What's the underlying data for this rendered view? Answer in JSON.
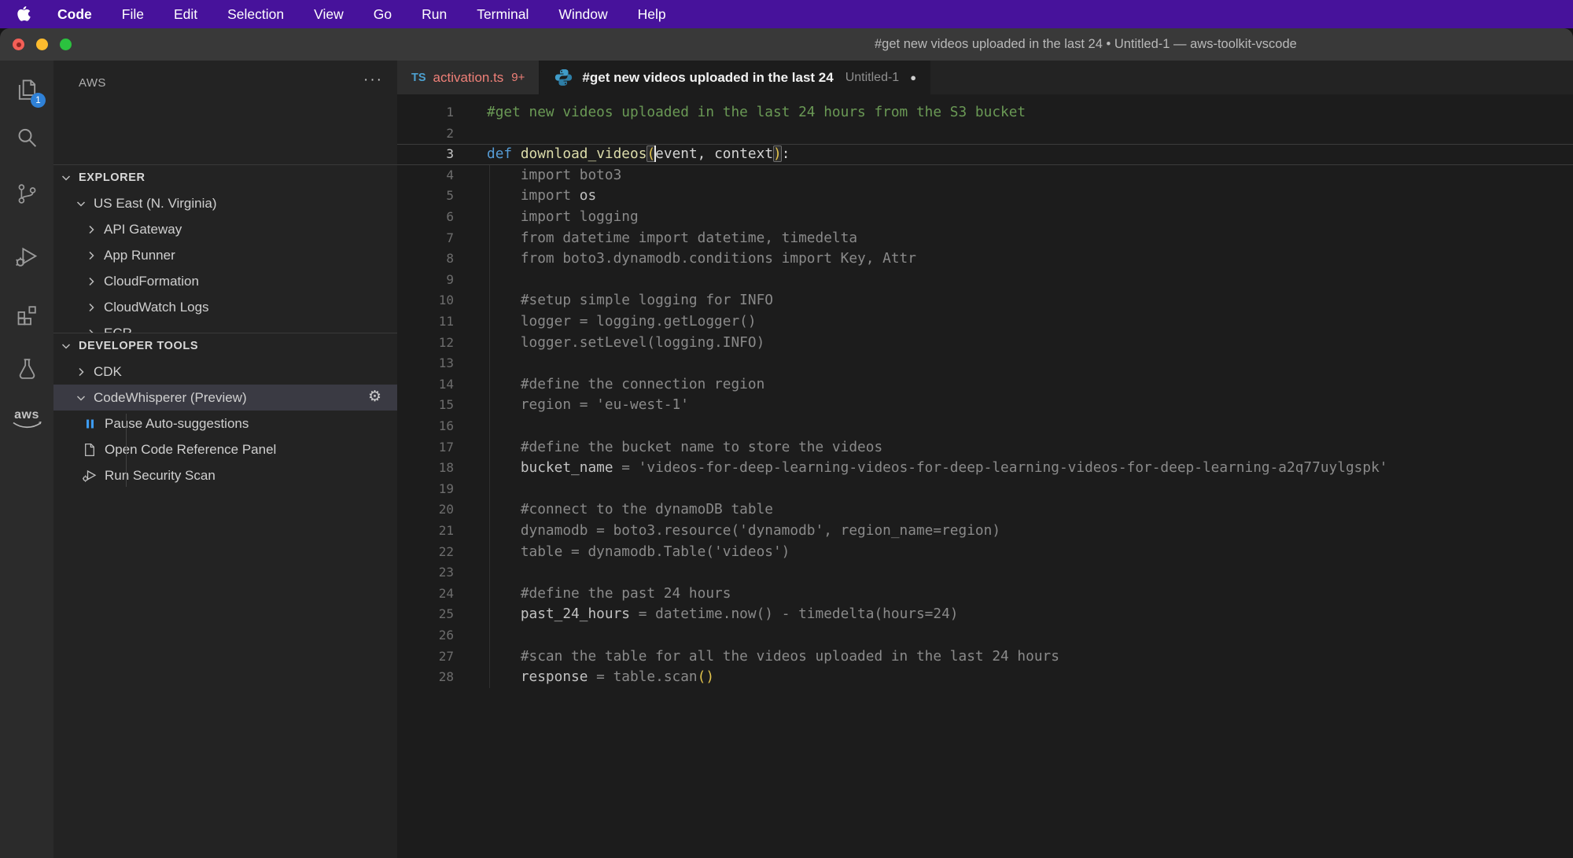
{
  "colors": {
    "menubar": "#47129b",
    "badge": "#2f81d7",
    "rowsel": "#3a3a43",
    "error": "#ef8078",
    "comment": "#6a9955",
    "keyword": "#569cd6",
    "function": "#dcdcaa",
    "bracket": "#e2c34c",
    "ghost": "#8a8a8a",
    "pause": "#3d9bf0"
  },
  "menu_bar": {
    "apple_icon": "apple-icon",
    "items": [
      {
        "label": "Code",
        "bold": true
      },
      {
        "label": "File"
      },
      {
        "label": "Edit"
      },
      {
        "label": "Selection"
      },
      {
        "label": "View"
      },
      {
        "label": "Go"
      },
      {
        "label": "Run"
      },
      {
        "label": "Terminal"
      },
      {
        "label": "Window"
      },
      {
        "label": "Help"
      }
    ]
  },
  "title_bar": {
    "title": "#get new videos uploaded in the last 24 • Untitled-1 — aws-toolkit-vscode",
    "window_controls": [
      "close",
      "minimize",
      "zoom"
    ]
  },
  "activity_bar": {
    "icons": [
      {
        "name": "explorer-icon",
        "badge": "1"
      },
      {
        "name": "search-icon"
      },
      {
        "name": "source-control-icon"
      },
      {
        "name": "run-debug-icon"
      },
      {
        "name": "extensions-icon"
      },
      {
        "name": "testing-icon"
      },
      {
        "name": "aws-icon",
        "text": "aws"
      }
    ]
  },
  "sidebar": {
    "title": "AWS",
    "more_actions": "···",
    "sections": [
      {
        "label": "EXPLORER",
        "items": [
          {
            "label": "US East (N. Virginia)",
            "level": 1,
            "chevron": "down"
          },
          {
            "label": "API Gateway",
            "level": 2,
            "chevron": "right"
          },
          {
            "label": "App Runner",
            "level": 2,
            "chevron": "right"
          },
          {
            "label": "CloudFormation",
            "level": 2,
            "chevron": "right"
          },
          {
            "label": "CloudWatch Logs",
            "level": 2,
            "chevron": "right"
          },
          {
            "label": "ECR",
            "level": 2,
            "chevron": "right",
            "clipped": true
          }
        ]
      },
      {
        "label": "DEVELOPER TOOLS",
        "items": [
          {
            "label": "CDK",
            "level": 1,
            "chevron": "right"
          },
          {
            "label": "CodeWhisperer (Preview)",
            "level": 1,
            "chevron": "down",
            "selected": true,
            "gear": "⚙"
          },
          {
            "label": "Pause Auto-suggestions",
            "level": 2,
            "icon": "pause-icon",
            "guide": true
          },
          {
            "label": "Open Code Reference Panel",
            "level": 2,
            "icon": "file-icon",
            "guide": true
          },
          {
            "label": "Run Security Scan",
            "level": 2,
            "icon": "security-scan-icon",
            "guide": true
          }
        ]
      }
    ]
  },
  "tabs": [
    {
      "icon": "typescript-icon",
      "icon_text": "TS",
      "label": "activation.ts",
      "badge": "9+",
      "active": false
    },
    {
      "icon": "python-icon",
      "label": "#get new videos uploaded in the last 24",
      "detail": "Untitled-1",
      "modified": "●",
      "active": true
    }
  ],
  "editor": {
    "line_numbers": true,
    "current_line": 3,
    "lines": [
      {
        "n": 1,
        "seg": [
          {
            "s": "c",
            "t": "#get new videos uploaded in the last 24 hours from the S3 bucket"
          }
        ]
      },
      {
        "n": 2,
        "seg": []
      },
      {
        "n": 3,
        "seg": [
          {
            "s": "k",
            "t": "def"
          },
          {
            "s": "p",
            "t": " "
          },
          {
            "s": "f",
            "t": "download_videos"
          },
          {
            "s": "b",
            "t": "("
          },
          {
            "cursor": true
          },
          {
            "s": "p",
            "t": "event, context"
          },
          {
            "s": "b",
            "t": ")"
          },
          {
            "s": "p",
            "t": ":"
          }
        ]
      },
      {
        "n": 4,
        "seg": [
          {
            "s": "g",
            "t": "    import boto3"
          }
        ]
      },
      {
        "n": 5,
        "seg": [
          {
            "s": "g",
            "t": "    import "
          },
          {
            "s": "G",
            "t": "os"
          }
        ]
      },
      {
        "n": 6,
        "seg": [
          {
            "s": "g",
            "t": "    import logging"
          }
        ]
      },
      {
        "n": 7,
        "seg": [
          {
            "s": "g",
            "t": "    from datetime import datetime, timedelta"
          }
        ]
      },
      {
        "n": 8,
        "seg": [
          {
            "s": "g",
            "t": "    from boto3.dynamodb.conditions import Key, Attr"
          }
        ]
      },
      {
        "n": 9,
        "seg": []
      },
      {
        "n": 10,
        "seg": [
          {
            "s": "g",
            "t": "    #setup simple logging for INFO"
          }
        ]
      },
      {
        "n": 11,
        "seg": [
          {
            "s": "g",
            "t": "    logger = logging.getLogger()"
          }
        ]
      },
      {
        "n": 12,
        "seg": [
          {
            "s": "g",
            "t": "    logger.setLevel(logging.INFO)"
          }
        ]
      },
      {
        "n": 13,
        "seg": []
      },
      {
        "n": 14,
        "seg": [
          {
            "s": "g",
            "t": "    #define the connection region"
          }
        ]
      },
      {
        "n": 15,
        "seg": [
          {
            "s": "g",
            "t": "    region = 'eu-west-1'"
          }
        ]
      },
      {
        "n": 16,
        "seg": []
      },
      {
        "n": 17,
        "seg": [
          {
            "s": "g",
            "t": "    #define the bucket name to store the videos"
          }
        ]
      },
      {
        "n": 18,
        "seg": [
          {
            "s": "G",
            "t": "    bucket_name"
          },
          {
            "s": "g",
            "t": " = 'videos-for-deep-learning-videos-for-deep-learning-videos-for-deep-learning-a2q77uylgspk'"
          }
        ]
      },
      {
        "n": 19,
        "seg": []
      },
      {
        "n": 20,
        "seg": [
          {
            "s": "g",
            "t": "    #connect to the dynamoDB table"
          }
        ]
      },
      {
        "n": 21,
        "seg": [
          {
            "s": "g",
            "t": "    dynamodb = boto3.resource('dynamodb', region_name=region)"
          }
        ]
      },
      {
        "n": 22,
        "seg": [
          {
            "s": "g",
            "t": "    table = dynamodb.Table('videos')"
          }
        ]
      },
      {
        "n": 23,
        "seg": []
      },
      {
        "n": 24,
        "seg": [
          {
            "s": "g",
            "t": "    #define the past 24 hours"
          }
        ]
      },
      {
        "n": 25,
        "seg": [
          {
            "s": "G",
            "t": "    past_24_hours"
          },
          {
            "s": "g",
            "t": " = datetime.now() - timedelta(hours=24)"
          }
        ]
      },
      {
        "n": 26,
        "seg": []
      },
      {
        "n": 27,
        "seg": [
          {
            "s": "g",
            "t": "    #scan the table for all the videos uploaded in the last 24 hours"
          }
        ]
      },
      {
        "n": 28,
        "seg": [
          {
            "s": "G",
            "t": "    response"
          },
          {
            "s": "g",
            "t": " = table.scan"
          },
          {
            "s": "y",
            "t": "()"
          }
        ]
      }
    ]
  }
}
